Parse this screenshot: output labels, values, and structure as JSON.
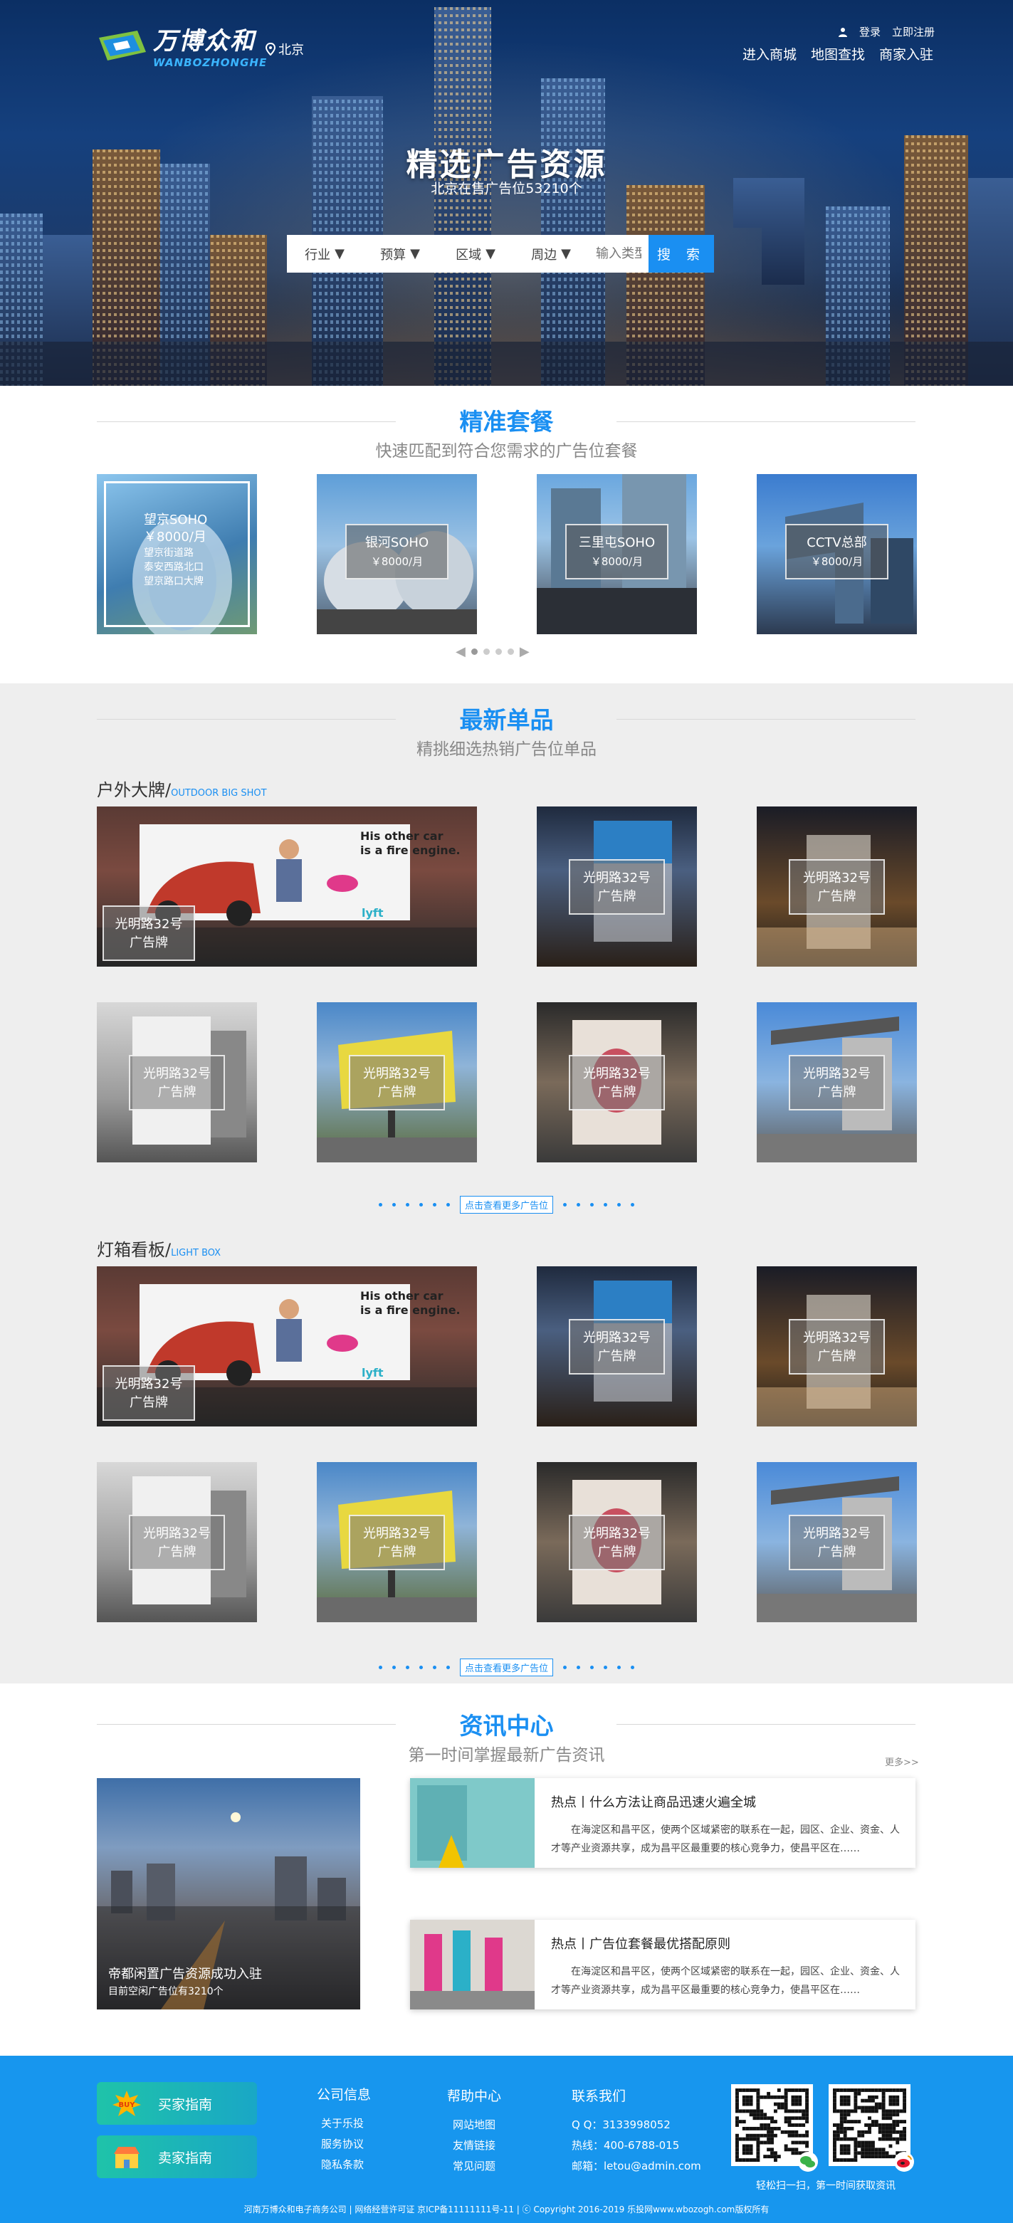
{
  "brand": {
    "cn": "万博众和",
    "en": "WANBOZHONGHE",
    "city": "北京"
  },
  "auth": {
    "login": "登录",
    "register": "立即注册"
  },
  "nav": [
    "进入商城",
    "地图查找",
    "商家入驻"
  ],
  "hero": {
    "title": "精选广告资源",
    "subtitle": "北京在售广告位53210个"
  },
  "search": {
    "filters": [
      "行业",
      "预算",
      "区域",
      "周边"
    ],
    "placeholder": "输入类型",
    "button": "搜 索"
  },
  "packages": {
    "title": "精准套餐",
    "subtitle": "快速匹配到符合您需求的广告位套餐",
    "items": [
      {
        "name": "望京SOHO",
        "price": "￥8000/月",
        "details": [
          "望京街道路",
          "泰安西路北口",
          "望京路口大牌"
        ]
      },
      {
        "name": "银河SOHO",
        "price": "￥8000/月"
      },
      {
        "name": "三里屯SOHO",
        "price": "￥8000/月"
      },
      {
        "name": "CCTV总部",
        "price": "￥8000/月"
      }
    ],
    "prev": "◀",
    "next": "▶"
  },
  "latest": {
    "title": "最新单品",
    "subtitle": "精挑细选热销广告位单品",
    "categories": [
      {
        "cn": "户外大牌",
        "en": "OUTDOOR BIG SHOT"
      },
      {
        "cn": "灯箱看板",
        "en": "LIGHT BOX"
      }
    ],
    "card_title": "光明路32号",
    "card_sub": "广告牌",
    "billboard": {
      "head1": "His other car",
      "head2": "is a fire engine.",
      "brand": "lyft"
    },
    "more": "点击查看更多广告位"
  },
  "news": {
    "title": "资讯中心",
    "subtitle": "第一时间掌握最新广告资讯",
    "more": "更多>>",
    "feature": {
      "title": "帝都闲置广告资源成功入驻",
      "sub": "目前空闲广告位有3210个"
    },
    "items": [
      {
        "title": "热点丨什么方法让商品迅速火遍全城",
        "body": "在海淀区和昌平区，使两个区域紧密的联系在一起，园区、企业、资金、人才等产业资源共享，成为昌平区最重要的核心竞争力，使昌平区在……"
      },
      {
        "title": "热点丨广告位套餐最优搭配原则",
        "body": "在海淀区和昌平区，使两个区域紧密的联系在一起，园区、企业、资金、人才等产业资源共享，成为昌平区最重要的核心竞争力，使昌平区在……"
      }
    ]
  },
  "footer": {
    "buy": "买家指南",
    "buy_badge": "BUY",
    "sell": "卖家指南",
    "cols": [
      {
        "head": "公司信息",
        "items": [
          "关于乐投",
          "服务协议",
          "隐私条款"
        ]
      },
      {
        "head": "帮助中心",
        "items": [
          "网站地图",
          "友情链接",
          "常见问题"
        ]
      },
      {
        "head": "联系我们",
        "items": [
          "Q Q：3133998052",
          "热线：400-6788-015",
          "邮箱：letou@admin.com"
        ]
      }
    ],
    "qr_caption": "轻松扫一扫，第一时间获取资讯",
    "copyright": "河南万博众和电子商务公司 | 网络经营许可证 京ICP备11111111号-11 | ⓒ Copyright 2016-2019  乐投网www.wbozogh.com版权所有"
  },
  "colors": {
    "accent": "#1a8ff2",
    "footer": "#1796ee",
    "gray": "#eeeeee"
  }
}
